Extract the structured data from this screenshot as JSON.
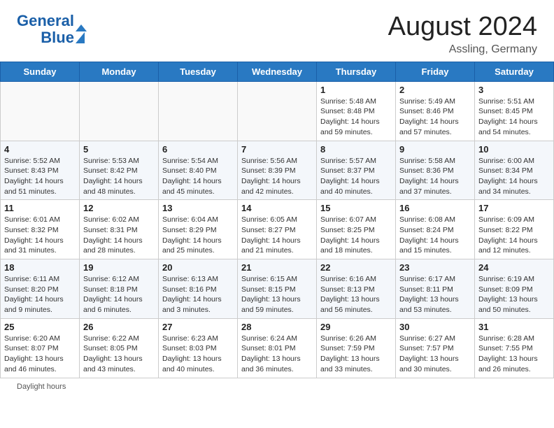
{
  "header": {
    "logo_line1": "General",
    "logo_line2": "Blue",
    "month_year": "August 2024",
    "location": "Assling, Germany"
  },
  "days_of_week": [
    "Sunday",
    "Monday",
    "Tuesday",
    "Wednesday",
    "Thursday",
    "Friday",
    "Saturday"
  ],
  "weeks": [
    [
      {
        "day": "",
        "info": ""
      },
      {
        "day": "",
        "info": ""
      },
      {
        "day": "",
        "info": ""
      },
      {
        "day": "",
        "info": ""
      },
      {
        "day": "1",
        "info": "Sunrise: 5:48 AM\nSunset: 8:48 PM\nDaylight: 14 hours and 59 minutes."
      },
      {
        "day": "2",
        "info": "Sunrise: 5:49 AM\nSunset: 8:46 PM\nDaylight: 14 hours and 57 minutes."
      },
      {
        "day": "3",
        "info": "Sunrise: 5:51 AM\nSunset: 8:45 PM\nDaylight: 14 hours and 54 minutes."
      }
    ],
    [
      {
        "day": "4",
        "info": "Sunrise: 5:52 AM\nSunset: 8:43 PM\nDaylight: 14 hours and 51 minutes."
      },
      {
        "day": "5",
        "info": "Sunrise: 5:53 AM\nSunset: 8:42 PM\nDaylight: 14 hours and 48 minutes."
      },
      {
        "day": "6",
        "info": "Sunrise: 5:54 AM\nSunset: 8:40 PM\nDaylight: 14 hours and 45 minutes."
      },
      {
        "day": "7",
        "info": "Sunrise: 5:56 AM\nSunset: 8:39 PM\nDaylight: 14 hours and 42 minutes."
      },
      {
        "day": "8",
        "info": "Sunrise: 5:57 AM\nSunset: 8:37 PM\nDaylight: 14 hours and 40 minutes."
      },
      {
        "day": "9",
        "info": "Sunrise: 5:58 AM\nSunset: 8:36 PM\nDaylight: 14 hours and 37 minutes."
      },
      {
        "day": "10",
        "info": "Sunrise: 6:00 AM\nSunset: 8:34 PM\nDaylight: 14 hours and 34 minutes."
      }
    ],
    [
      {
        "day": "11",
        "info": "Sunrise: 6:01 AM\nSunset: 8:32 PM\nDaylight: 14 hours and 31 minutes."
      },
      {
        "day": "12",
        "info": "Sunrise: 6:02 AM\nSunset: 8:31 PM\nDaylight: 14 hours and 28 minutes."
      },
      {
        "day": "13",
        "info": "Sunrise: 6:04 AM\nSunset: 8:29 PM\nDaylight: 14 hours and 25 minutes."
      },
      {
        "day": "14",
        "info": "Sunrise: 6:05 AM\nSunset: 8:27 PM\nDaylight: 14 hours and 21 minutes."
      },
      {
        "day": "15",
        "info": "Sunrise: 6:07 AM\nSunset: 8:25 PM\nDaylight: 14 hours and 18 minutes."
      },
      {
        "day": "16",
        "info": "Sunrise: 6:08 AM\nSunset: 8:24 PM\nDaylight: 14 hours and 15 minutes."
      },
      {
        "day": "17",
        "info": "Sunrise: 6:09 AM\nSunset: 8:22 PM\nDaylight: 14 hours and 12 minutes."
      }
    ],
    [
      {
        "day": "18",
        "info": "Sunrise: 6:11 AM\nSunset: 8:20 PM\nDaylight: 14 hours and 9 minutes."
      },
      {
        "day": "19",
        "info": "Sunrise: 6:12 AM\nSunset: 8:18 PM\nDaylight: 14 hours and 6 minutes."
      },
      {
        "day": "20",
        "info": "Sunrise: 6:13 AM\nSunset: 8:16 PM\nDaylight: 14 hours and 3 minutes."
      },
      {
        "day": "21",
        "info": "Sunrise: 6:15 AM\nSunset: 8:15 PM\nDaylight: 13 hours and 59 minutes."
      },
      {
        "day": "22",
        "info": "Sunrise: 6:16 AM\nSunset: 8:13 PM\nDaylight: 13 hours and 56 minutes."
      },
      {
        "day": "23",
        "info": "Sunrise: 6:17 AM\nSunset: 8:11 PM\nDaylight: 13 hours and 53 minutes."
      },
      {
        "day": "24",
        "info": "Sunrise: 6:19 AM\nSunset: 8:09 PM\nDaylight: 13 hours and 50 minutes."
      }
    ],
    [
      {
        "day": "25",
        "info": "Sunrise: 6:20 AM\nSunset: 8:07 PM\nDaylight: 13 hours and 46 minutes."
      },
      {
        "day": "26",
        "info": "Sunrise: 6:22 AM\nSunset: 8:05 PM\nDaylight: 13 hours and 43 minutes."
      },
      {
        "day": "27",
        "info": "Sunrise: 6:23 AM\nSunset: 8:03 PM\nDaylight: 13 hours and 40 minutes."
      },
      {
        "day": "28",
        "info": "Sunrise: 6:24 AM\nSunset: 8:01 PM\nDaylight: 13 hours and 36 minutes."
      },
      {
        "day": "29",
        "info": "Sunrise: 6:26 AM\nSunset: 7:59 PM\nDaylight: 13 hours and 33 minutes."
      },
      {
        "day": "30",
        "info": "Sunrise: 6:27 AM\nSunset: 7:57 PM\nDaylight: 13 hours and 30 minutes."
      },
      {
        "day": "31",
        "info": "Sunrise: 6:28 AM\nSunset: 7:55 PM\nDaylight: 13 hours and 26 minutes."
      }
    ]
  ],
  "footer": {
    "daylight_label": "Daylight hours"
  }
}
